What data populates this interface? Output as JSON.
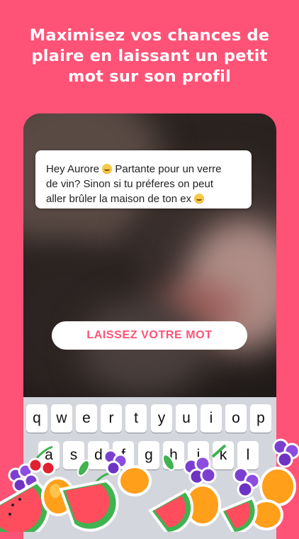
{
  "headline": {
    "line1": "Maximisez vos chances de",
    "line2": "plaire en laissant un petit",
    "line3": "mot sur son profil"
  },
  "message": {
    "line1_a": "Hey Aurore ",
    "line1_b": " Partante pour un verre",
    "line2": "de vin? Sinon si tu préferes on peut",
    "line3_a": "aller brûler la maison de ton ex ",
    "emoji": "grinning-face-icon"
  },
  "cta": {
    "label": "LAISSEZ VOTRE MOT"
  },
  "keyboard": {
    "row1": [
      "q",
      "w",
      "e",
      "r",
      "t",
      "y",
      "u",
      "i",
      "o",
      "p"
    ],
    "row2": [
      "a",
      "s",
      "d",
      "f",
      "g",
      "h",
      "j",
      "k",
      "l"
    ]
  },
  "colors": {
    "background": "#ff5277",
    "accent": "#ff5277",
    "card": "#ffffff",
    "keyboard": "#d3d6dc"
  }
}
